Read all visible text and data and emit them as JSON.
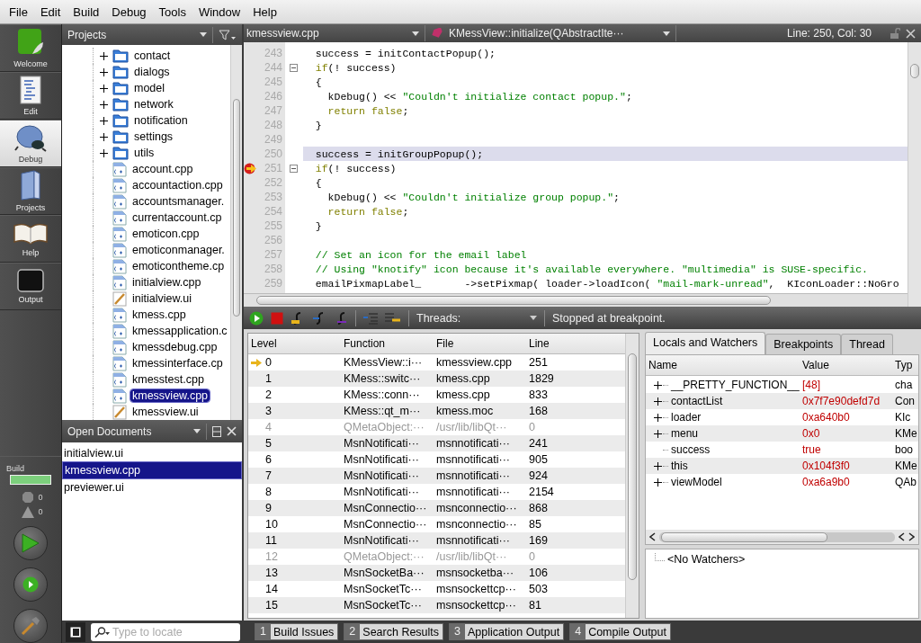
{
  "menu": [
    "File",
    "Edit",
    "Build",
    "Debug",
    "Tools",
    "Window",
    "Help"
  ],
  "modes": [
    {
      "label": "Welcome",
      "kind": "welcome",
      "selected": false
    },
    {
      "label": "Edit",
      "kind": "edit",
      "selected": false
    },
    {
      "label": "Debug",
      "kind": "debug",
      "selected": true
    },
    {
      "label": "Projects",
      "kind": "projects",
      "selected": false
    },
    {
      "label": "Help",
      "kind": "help",
      "selected": false
    },
    {
      "label": "Output",
      "kind": "output",
      "selected": false
    }
  ],
  "build": {
    "label": "Build",
    "level": 1,
    "errors": "0",
    "warnings": "0"
  },
  "projects": {
    "title": "Projects",
    "items": [
      {
        "name": "contact",
        "kind": "folder",
        "expanded": false,
        "selected": false
      },
      {
        "name": "dialogs",
        "kind": "folder",
        "expanded": false,
        "selected": false
      },
      {
        "name": "model",
        "kind": "folder",
        "expanded": false,
        "selected": false
      },
      {
        "name": "network",
        "kind": "folder",
        "expanded": false,
        "selected": false
      },
      {
        "name": "notification",
        "kind": "folder",
        "expanded": false,
        "selected": false
      },
      {
        "name": "settings",
        "kind": "folder",
        "expanded": false,
        "selected": false
      },
      {
        "name": "utils",
        "kind": "folder",
        "expanded": false,
        "selected": false
      },
      {
        "name": "account.cpp",
        "kind": "cpp",
        "selected": false
      },
      {
        "name": "accountaction.cpp",
        "kind": "cpp",
        "selected": false
      },
      {
        "name": "accountsmanager.",
        "kind": "cpp",
        "selected": false
      },
      {
        "name": "currentaccount.cp",
        "kind": "cpp",
        "selected": false
      },
      {
        "name": "emoticon.cpp",
        "kind": "cpp",
        "selected": false
      },
      {
        "name": "emoticonmanager.",
        "kind": "cpp",
        "selected": false
      },
      {
        "name": "emoticontheme.cp",
        "kind": "cpp",
        "selected": false
      },
      {
        "name": "initialview.cpp",
        "kind": "cpp",
        "selected": false
      },
      {
        "name": "initialview.ui",
        "kind": "ui",
        "selected": false
      },
      {
        "name": "kmess.cpp",
        "kind": "cpp",
        "selected": false
      },
      {
        "name": "kmessapplication.c",
        "kind": "cpp",
        "selected": false
      },
      {
        "name": "kmessdebug.cpp",
        "kind": "cpp",
        "selected": false
      },
      {
        "name": "kmessinterface.cp",
        "kind": "cpp",
        "selected": false
      },
      {
        "name": "kmesstest.cpp",
        "kind": "cpp",
        "selected": false
      },
      {
        "name": "kmessview.cpp",
        "kind": "cpp",
        "selected": true
      },
      {
        "name": "kmessview.ui",
        "kind": "ui",
        "selected": false
      }
    ]
  },
  "open_documents": {
    "title": "Open Documents",
    "items": [
      {
        "name": "initialview.ui",
        "selected": false
      },
      {
        "name": "kmessview.cpp",
        "selected": true
      },
      {
        "name": "previewer.ui",
        "selected": false
      }
    ]
  },
  "editor": {
    "file": "kmessview.cpp",
    "function": "KMessView::initialize(QAbstractIte···",
    "position": "Line: 250, Col: 30",
    "lines": [
      {
        "number": "243",
        "current": false,
        "breakpoint": false,
        "fold": false,
        "tokens": [
          {
            "kind": "plain",
            "text": "  success = initContactPopup();"
          }
        ]
      },
      {
        "number": "244",
        "current": false,
        "breakpoint": false,
        "fold": true,
        "tokens": [
          {
            "kind": "keyword",
            "text": "  if"
          },
          {
            "kind": "plain",
            "text": "(! success)"
          }
        ]
      },
      {
        "number": "245",
        "current": false,
        "breakpoint": false,
        "fold": false,
        "tokens": [
          {
            "kind": "plain",
            "text": "  {"
          }
        ]
      },
      {
        "number": "246",
        "current": false,
        "breakpoint": false,
        "fold": false,
        "tokens": [
          {
            "kind": "plain",
            "text": "    kDebug() << "
          },
          {
            "kind": "string",
            "text": "\"Couldn't initialize contact popup.\""
          },
          {
            "kind": "plain",
            "text": ";"
          }
        ]
      },
      {
        "number": "247",
        "current": false,
        "breakpoint": false,
        "fold": false,
        "tokens": [
          {
            "kind": "keyword",
            "text": "    return false"
          },
          {
            "kind": "plain",
            "text": ";"
          }
        ]
      },
      {
        "number": "248",
        "current": false,
        "breakpoint": false,
        "fold": false,
        "tokens": [
          {
            "kind": "plain",
            "text": "  }"
          }
        ]
      },
      {
        "number": "249",
        "current": false,
        "breakpoint": false,
        "fold": false
      },
      {
        "number": "250",
        "current": true,
        "breakpoint": false,
        "fold": false,
        "tokens": [
          {
            "kind": "plain",
            "text": "  success = initGroupPopup();"
          }
        ]
      },
      {
        "number": "251",
        "current": false,
        "breakpoint": true,
        "fold": true,
        "tokens": [
          {
            "kind": "keyword",
            "text": "  if"
          },
          {
            "kind": "plain",
            "text": "(! success)"
          }
        ]
      },
      {
        "number": "252",
        "current": false,
        "breakpoint": false,
        "fold": false,
        "tokens": [
          {
            "kind": "plain",
            "text": "  {"
          }
        ]
      },
      {
        "number": "253",
        "current": false,
        "breakpoint": false,
        "fold": false,
        "tokens": [
          {
            "kind": "plain",
            "text": "    kDebug() << "
          },
          {
            "kind": "string",
            "text": "\"Couldn't initialize group popup.\""
          },
          {
            "kind": "plain",
            "text": ";"
          }
        ]
      },
      {
        "number": "254",
        "current": false,
        "breakpoint": false,
        "fold": false,
        "tokens": [
          {
            "kind": "keyword",
            "text": "    return false"
          },
          {
            "kind": "plain",
            "text": ";"
          }
        ]
      },
      {
        "number": "255",
        "current": false,
        "breakpoint": false,
        "fold": false,
        "tokens": [
          {
            "kind": "plain",
            "text": "  }"
          }
        ]
      },
      {
        "number": "256",
        "current": false,
        "breakpoint": false,
        "fold": false
      },
      {
        "number": "257",
        "current": false,
        "breakpoint": false,
        "fold": false,
        "tokens": [
          {
            "kind": "comment",
            "text": "  // Set an icon for the email label"
          }
        ]
      },
      {
        "number": "258",
        "current": false,
        "breakpoint": false,
        "fold": false,
        "tokens": [
          {
            "kind": "comment",
            "text": "  // Using \"knotify\" icon because it's available everywhere. \"multimedia\" is SUSE-specific."
          }
        ]
      },
      {
        "number": "259",
        "current": false,
        "breakpoint": false,
        "fold": false,
        "tokens": [
          {
            "kind": "plain",
            "text": "  emailPixmapLabel_       ->setPixmap( loader->loadIcon( "
          },
          {
            "kind": "string",
            "text": "\"mail-mark-unread\""
          },
          {
            "kind": "plain",
            "text": ",  KIconLoader::NoGro"
          }
        ]
      }
    ]
  },
  "debug_toolbar": {
    "threads_label": "Threads:",
    "status": "Stopped at breakpoint."
  },
  "stack": {
    "columns": [
      "Level",
      "Function",
      "File",
      "Line"
    ],
    "rows": [
      {
        "level": "0",
        "function": "KMessView::i···",
        "file": "kmessview.cpp",
        "line": "251",
        "current": true,
        "disabled": false
      },
      {
        "level": "1",
        "function": "KMess::switc···",
        "file": "kmess.cpp",
        "line": "1829",
        "current": false,
        "disabled": false
      },
      {
        "level": "2",
        "function": "KMess::conn···",
        "file": "kmess.cpp",
        "line": "833",
        "current": false,
        "disabled": false
      },
      {
        "level": "3",
        "function": "KMess::qt_m···",
        "file": "kmess.moc",
        "line": "168",
        "current": false,
        "disabled": false
      },
      {
        "level": "4",
        "function": "QMetaObject:···",
        "file": "/usr/lib/libQt···",
        "line": "0",
        "current": false,
        "disabled": true
      },
      {
        "level": "5",
        "function": "MsnNotificati···",
        "file": "msnnotificati···",
        "line": "241",
        "current": false,
        "disabled": false
      },
      {
        "level": "6",
        "function": "MsnNotificati···",
        "file": "msnnotificati···",
        "line": "905",
        "current": false,
        "disabled": false
      },
      {
        "level": "7",
        "function": "MsnNotificati···",
        "file": "msnnotificati···",
        "line": "924",
        "current": false,
        "disabled": false
      },
      {
        "level": "8",
        "function": "MsnNotificati···",
        "file": "msnnotificati···",
        "line": "2154",
        "current": false,
        "disabled": false
      },
      {
        "level": "9",
        "function": "MsnConnectio···",
        "file": "msnconnectio···",
        "line": "868",
        "current": false,
        "disabled": false
      },
      {
        "level": "10",
        "function": "MsnConnectio···",
        "file": "msnconnectio···",
        "line": "85",
        "current": false,
        "disabled": false
      },
      {
        "level": "11",
        "function": "MsnNotificati···",
        "file": "msnnotificati···",
        "line": "169",
        "current": false,
        "disabled": false
      },
      {
        "level": "12",
        "function": "QMetaObject:···",
        "file": "/usr/lib/libQt···",
        "line": "0",
        "current": false,
        "disabled": true
      },
      {
        "level": "13",
        "function": "MsnSocketBa···",
        "file": "msnsocketba···",
        "line": "106",
        "current": false,
        "disabled": false
      },
      {
        "level": "14",
        "function": "MsnSocketTc···",
        "file": "msnsockettcp···",
        "line": "503",
        "current": false,
        "disabled": false
      },
      {
        "level": "15",
        "function": "MsnSocketTc···",
        "file": "msnsockettcp···",
        "line": "81",
        "current": false,
        "disabled": false
      }
    ]
  },
  "locals": {
    "tabs": [
      {
        "label": "Locals and Watchers",
        "selected": true
      },
      {
        "label": "Breakpoints",
        "selected": false
      },
      {
        "label": "Thread",
        "selected": false
      }
    ],
    "columns": [
      "Name",
      "Value",
      "Typ"
    ],
    "rows": [
      {
        "name": "__PRETTY_FUNCTION__",
        "value": "[48]",
        "type": "cha",
        "expandable": true
      },
      {
        "name": "contactList",
        "value": "0x7f7e90defd7d",
        "type": "Con",
        "expandable": true
      },
      {
        "name": "loader",
        "value": "0xa640b0",
        "type": "KIc",
        "expandable": true
      },
      {
        "name": "menu",
        "value": "0x0",
        "type": "KMe",
        "expandable": true
      },
      {
        "name": "success",
        "value": "true",
        "type": "boo",
        "expandable": false
      },
      {
        "name": "this",
        "value": "0x104f3f0",
        "type": "KMe",
        "expandable": true
      },
      {
        "name": "viewModel",
        "value": "0xa6a9b0",
        "type": "QAb",
        "expandable": true
      }
    ],
    "watchers": "<No Watchers>"
  },
  "status_bar": {
    "locate_placeholder": "Type to locate",
    "panes": [
      {
        "number": "1",
        "label": "Build Issues"
      },
      {
        "number": "2",
        "label": "Search Results"
      },
      {
        "number": "3",
        "label": "Application Output"
      },
      {
        "number": "4",
        "label": "Compile Output"
      }
    ]
  }
}
